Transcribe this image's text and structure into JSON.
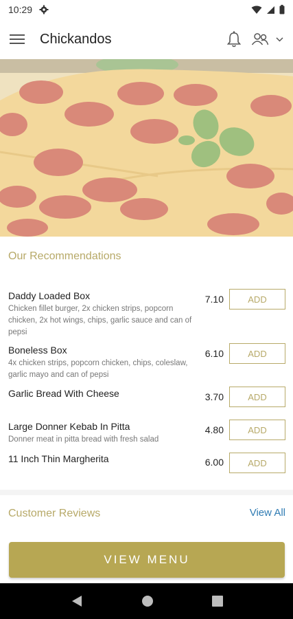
{
  "status_bar": {
    "time": "10:29"
  },
  "app_bar": {
    "title": "Chickandos"
  },
  "recommendations": {
    "title": "Our Recommendations",
    "items": [
      {
        "name": "Daddy Loaded Box",
        "description": "Chicken fillet burger, 2x chicken strips, popcorn chicken, 2x hot wings, chips, garlic sauce and can of pepsi",
        "price": "7.10",
        "add_label": "ADD"
      },
      {
        "name": "Boneless Box",
        "description": "4x chicken strips, popcorn chicken, chips, coleslaw, garlic mayo and can of pepsi",
        "price": "6.10",
        "add_label": "ADD"
      },
      {
        "name": "Garlic Bread With Cheese",
        "description": "",
        "price": "3.70",
        "add_label": "ADD"
      },
      {
        "name": "Large Donner Kebab In Pitta",
        "description": "Donner meat in pitta bread with fresh salad",
        "price": "4.80",
        "add_label": "ADD"
      },
      {
        "name": "11 Inch Thin Margherita",
        "description": "",
        "price": "6.00",
        "add_label": "ADD"
      }
    ]
  },
  "reviews": {
    "title": "Customer Reviews",
    "view_all": "View All"
  },
  "cta": {
    "label": "VIEW MENU"
  },
  "colors": {
    "accent": "#b7a968",
    "cta_bg": "#b7a753",
    "link": "#2f7bb3"
  }
}
